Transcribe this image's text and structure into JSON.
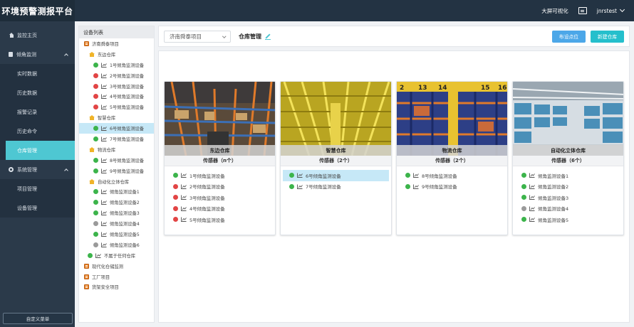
{
  "app": {
    "title": "环境预警测报平台"
  },
  "topbar": {
    "bigscreen_label": "大屏可视化",
    "username": "jnrstest"
  },
  "nav": {
    "items": [
      {
        "label": "监控主页"
      },
      {
        "label": "倾角监测"
      },
      {
        "label": "实时数据"
      },
      {
        "label": "历史数据"
      },
      {
        "label": "报警记录"
      },
      {
        "label": "历史命令"
      },
      {
        "label": "仓库管理"
      },
      {
        "label": "系统管理"
      },
      {
        "label": "项目管理"
      },
      {
        "label": "设备管理"
      }
    ],
    "custom_menu_label": "自定义菜单"
  },
  "tree": {
    "header": "设备列表",
    "nodes": [
      {
        "label": "济南舜泰项目"
      },
      {
        "label": "东边仓库"
      },
      {
        "label": "1号倾角监测设备",
        "status": "green"
      },
      {
        "label": "2号倾角监测设备",
        "status": "red"
      },
      {
        "label": "3号倾角监测设备",
        "status": "red"
      },
      {
        "label": "4号倾角监测设备",
        "status": "red"
      },
      {
        "label": "5号倾角监测设备",
        "status": "red"
      },
      {
        "label": "智慧仓库"
      },
      {
        "label": "6号倾角监测设备",
        "status": "green"
      },
      {
        "label": "7号倾角监测设备",
        "status": "green"
      },
      {
        "label": "物流仓库"
      },
      {
        "label": "8号倾角监测设备",
        "status": "green"
      },
      {
        "label": "9号倾角监测设备",
        "status": "green"
      },
      {
        "label": "自动化立体仓库"
      },
      {
        "label": "倾角监测设备1",
        "status": "green"
      },
      {
        "label": "倾角监测设备2",
        "status": "green"
      },
      {
        "label": "倾角监测设备3",
        "status": "green"
      },
      {
        "label": "倾角监测设备4",
        "status": "gray"
      },
      {
        "label": "倾角监测设备5",
        "status": "green"
      },
      {
        "label": "倾角监测设备6",
        "status": "gray"
      },
      {
        "label": "不属于任何仓库",
        "status": "green"
      },
      {
        "label": "现代化仓储监测"
      },
      {
        "label": "工厂项目"
      },
      {
        "label": "货架安全项目"
      }
    ]
  },
  "toolbar": {
    "project_select_value": "济南舜泰项目",
    "breadcrumb": "仓库管理",
    "layout_button": "布设点位",
    "new_button": "新建仓库"
  },
  "colors": {
    "accent": "#4ec7d2",
    "ok": "#3cb44b",
    "alarm": "#e24545",
    "offline": "#9a9a9a"
  },
  "warehouses": [
    {
      "name": "东边仓库",
      "count_label": "传感器（n个）",
      "sensors": [
        {
          "label": "1号倾角监测设备",
          "status": "green"
        },
        {
          "label": "2号倾角监测设备",
          "status": "red"
        },
        {
          "label": "3号倾角监测设备",
          "status": "red"
        },
        {
          "label": "4号倾角监测设备",
          "status": "red"
        },
        {
          "label": "5号倾角监测设备",
          "status": "red"
        }
      ]
    },
    {
      "name": "智慧仓库",
      "count_label": "传感器（2个）",
      "sensors": [
        {
          "label": "6号倾角监测设备",
          "status": "green"
        },
        {
          "label": "7号倾角监测设备",
          "status": "green"
        }
      ]
    },
    {
      "name": "物流仓库",
      "count_label": "传感器（2个）",
      "photo_numbers": [
        "2",
        "13",
        "14",
        "15",
        "16"
      ],
      "sensors": [
        {
          "label": "8号倾角监测设备",
          "status": "green"
        },
        {
          "label": "9号倾角监测设备",
          "status": "green"
        }
      ]
    },
    {
      "name": "自动化立体仓库",
      "count_label": "传感器（6个）",
      "sensors": [
        {
          "label": "倾角监测设备1",
          "status": "green"
        },
        {
          "label": "倾角监测设备2",
          "status": "green"
        },
        {
          "label": "倾角监测设备3",
          "status": "green"
        },
        {
          "label": "倾角监测设备4",
          "status": "gray"
        },
        {
          "label": "倾角监测设备5",
          "status": "green"
        }
      ]
    }
  ]
}
